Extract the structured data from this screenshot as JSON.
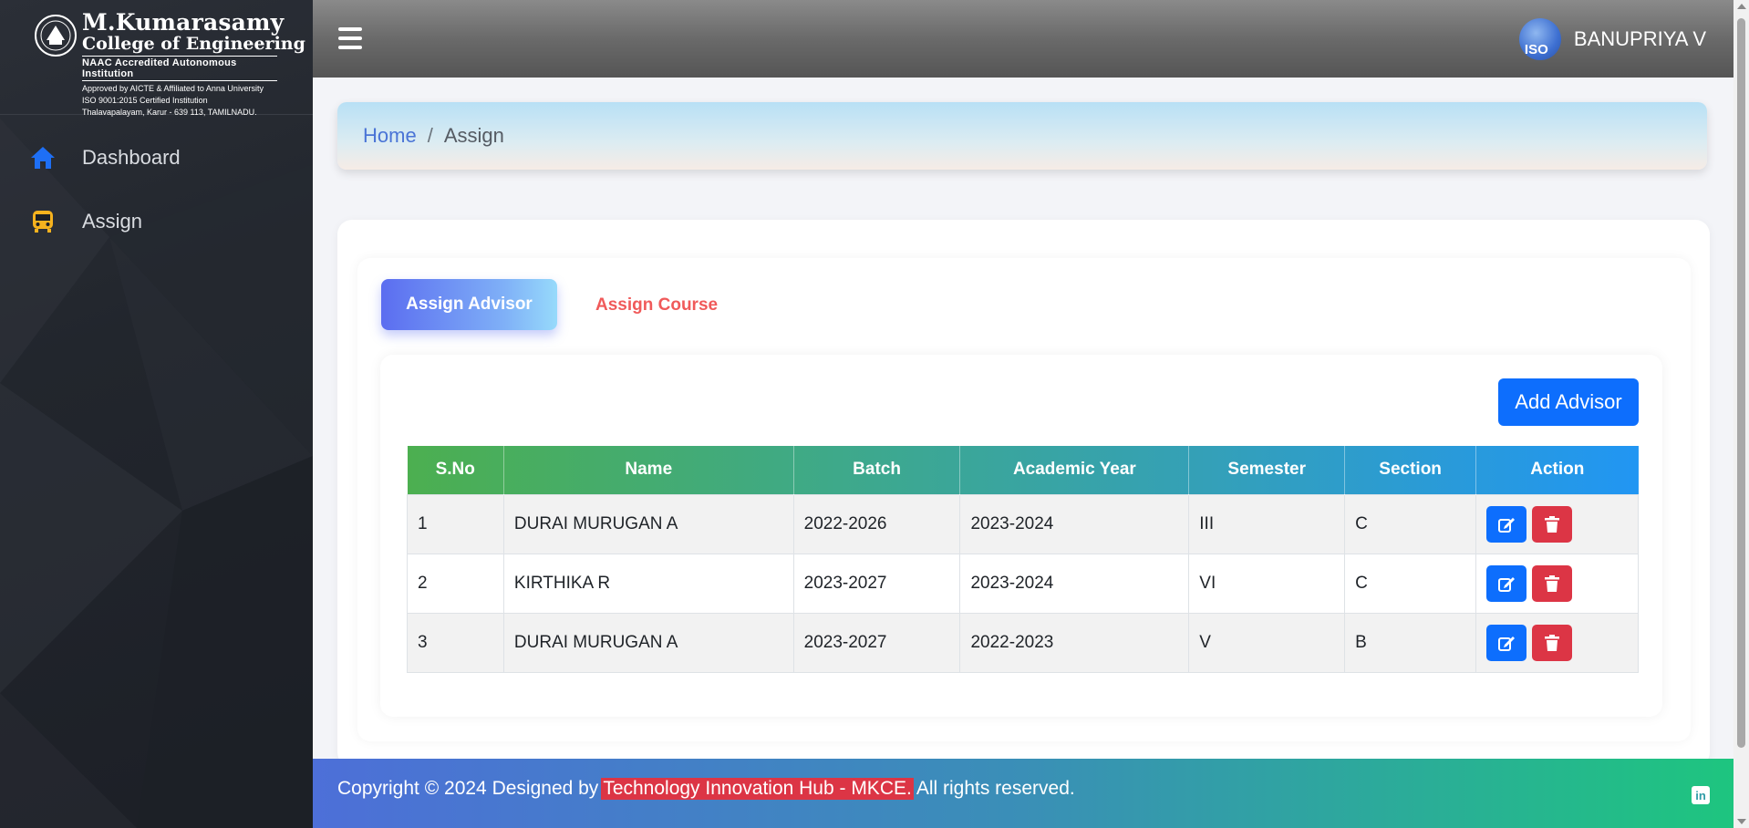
{
  "brand": {
    "name": "M.Kumarasamy",
    "sub": "College of Engineering",
    "naac": "NAAC Accredited Autonomous Institution",
    "line1": "Approved by AICTE & Affiliated to Anna University",
    "line2": "ISO 9001:2015 Certified Institution",
    "line3": "Thalavapalayam, Karur - 639 113, TAMILNADU."
  },
  "sidebar": {
    "items": [
      {
        "label": "Dashboard",
        "icon": "home-icon",
        "color": "#1e6ff5"
      },
      {
        "label": "Assign",
        "icon": "bus-icon",
        "color": "#f5b21e"
      }
    ]
  },
  "header": {
    "user_name": "BANUPRIYA V",
    "avatar_text": "ISO"
  },
  "breadcrumb": {
    "home": "Home",
    "separator": "/",
    "current": "Assign"
  },
  "tabs": {
    "active": "Assign Advisor",
    "inactive": "Assign Course"
  },
  "add_button": "Add Advisor",
  "table": {
    "headers": [
      "S.No",
      "Name",
      "Batch",
      "Academic Year",
      "Semester",
      "Section",
      "Action"
    ],
    "rows": [
      [
        "1",
        "DURAI MURUGAN A",
        "2022-2026",
        "2023-2024",
        "III",
        "C"
      ],
      [
        "2",
        "KIRTHIKA R",
        "2023-2027",
        "2023-2024",
        "VI",
        "C"
      ],
      [
        "3",
        "DURAI MURUGAN A",
        "2023-2027",
        "2022-2023",
        "V",
        "B"
      ]
    ]
  },
  "footer": {
    "prefix": "Copyright © 2024 Designed by",
    "highlight": "Technology Innovation Hub - MKCE.",
    "suffix": "All rights reserved.",
    "social": "in"
  },
  "colors": {
    "primary": "#0d6efd",
    "danger": "#dc3545",
    "table_header_start": "#4caf50",
    "table_header_end": "#2196f3"
  }
}
